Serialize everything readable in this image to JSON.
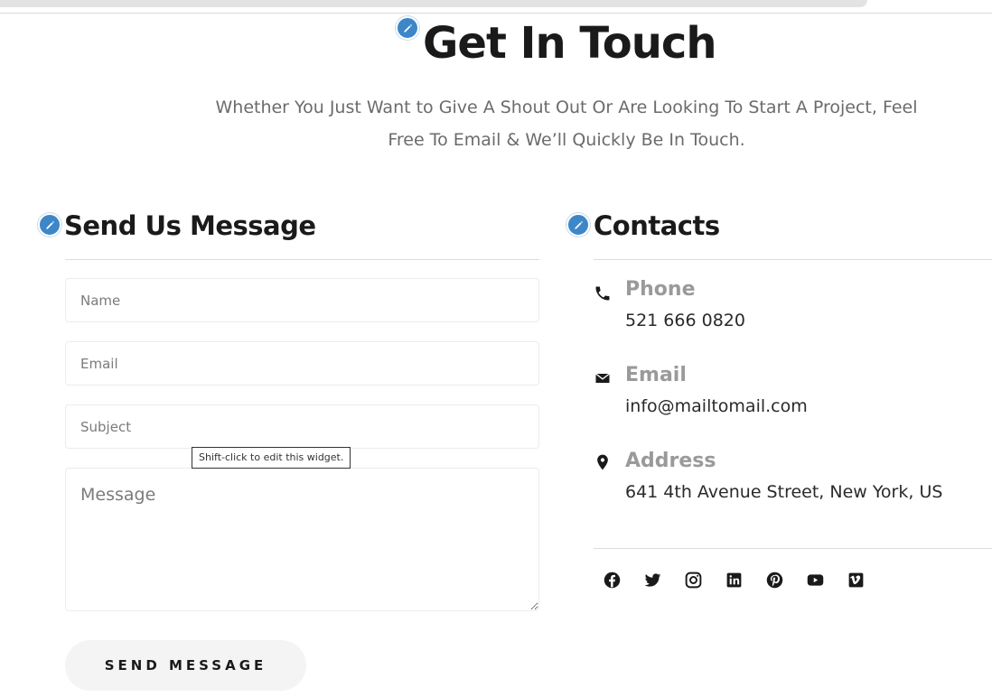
{
  "header": {
    "title": "Get In Touch",
    "intro_line1": "Whether You Just Want to Give A Shout Out Or Are Looking To Start A Project, Feel",
    "intro_line2": "Free To Email & We’ll Quickly Be In Touch."
  },
  "form": {
    "title": "Send Us Message",
    "name_placeholder": "Name",
    "email_placeholder": "Email",
    "subject_placeholder": "Subject",
    "message_placeholder": "Message",
    "submit_label": "SEND MESSAGE",
    "tooltip": "Shift-click to edit this widget."
  },
  "contacts": {
    "title": "Contacts",
    "items": [
      {
        "label": "Phone",
        "value": "521 666 0820",
        "icon": "phone-icon"
      },
      {
        "label": "Email",
        "value": "info@mailtomail.com",
        "icon": "envelope-icon"
      },
      {
        "label": "Address",
        "value": "641 4th Avenue Street, New York, US",
        "icon": "map-pin-icon"
      }
    ],
    "social": [
      "facebook-icon",
      "twitter-icon",
      "instagram-icon",
      "linkedin-icon",
      "pinterest-icon",
      "youtube-icon",
      "vimeo-icon"
    ]
  },
  "colors": {
    "edit_badge": "#3d87c8",
    "heading": "#1a1a1a",
    "muted_text": "#6b6b6b",
    "contact_label": "#9a9a9a",
    "button_bg": "#f4f4f4"
  }
}
